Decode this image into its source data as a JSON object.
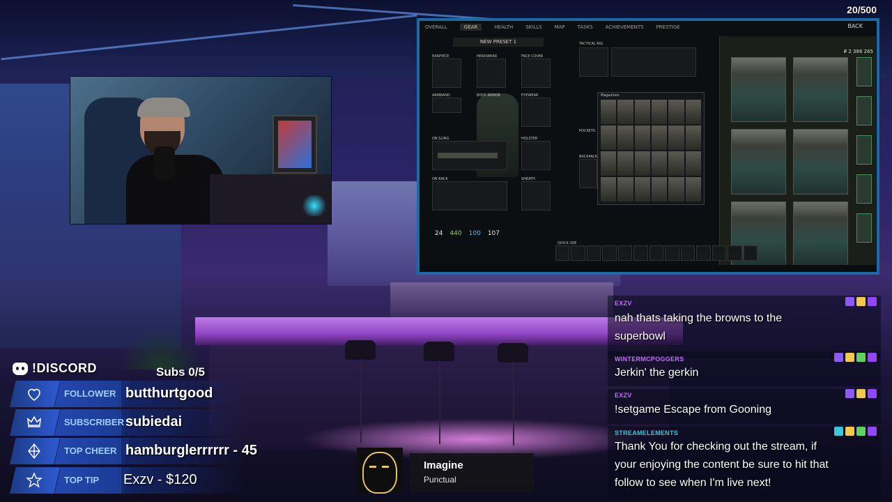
{
  "overlay": {
    "counter": "20/500",
    "discord_label": "!DISCORD",
    "subs": "Subs 0/5"
  },
  "stats": [
    {
      "label": "FOLLOWER",
      "value": "butthurtgood",
      "icon": "heart-icon"
    },
    {
      "label": "SUBSCRIBER",
      "value": "subiedai",
      "icon": "crown-icon"
    },
    {
      "label": "TOP CHEER",
      "value": "hamburglerrrrrr - 45",
      "icon": "diamond-icon"
    },
    {
      "label": "TOP TIP",
      "value": "Exzv - $120",
      "icon": "star-icon"
    }
  ],
  "music": {
    "title": "Imagine",
    "artist": "Punctual"
  },
  "game": {
    "menu": [
      "OVERALL",
      "GEAR",
      "HEALTH",
      "SKILLS",
      "MAP",
      "TASKS",
      "ACHIEVEMENTS",
      "PRESTIGE"
    ],
    "active_tab": "GEAR",
    "back_label": "BACK",
    "preset": "NEW PRESET 1",
    "slots": [
      "EARPIECE",
      "HEADWEAR",
      "FACE COVER",
      "ARMBAND",
      "BODY ARMOR",
      "EYEWEAR",
      "ON SLING",
      "HOLSTER",
      "ON BACK",
      "SHEATH",
      "TACTICAL RIG",
      "POCKETS",
      "BACKPACK"
    ],
    "magazines_title": "Magazines",
    "quick_use": "QUICK USE",
    "money": "₽ 2 386 265",
    "stats": {
      "level": "24",
      "health": "440",
      "hydration": "100",
      "energy": "107"
    }
  },
  "chat": [
    {
      "name": "EXZV",
      "name_color": "#c86bff",
      "text_lines": [
        "nah thats taking the browns to the",
        "superbowl"
      ],
      "badges": [
        "#8a5cf5",
        "#f2c94c",
        "#9146ff"
      ]
    },
    {
      "name": "WINTERMCPOGGERS",
      "name_color": "#c86bff",
      "text_lines": [
        "Jerkin' the gerkin"
      ],
      "badges": [
        "#8a5cf5",
        "#f2c94c",
        "#5fd35f",
        "#9146ff"
      ]
    },
    {
      "name": "EXZV",
      "name_color": "#c86bff",
      "text_lines": [
        "!setgame Escape from Gooning"
      ],
      "badges": [
        "#8a5cf5",
        "#f2c94c",
        "#9146ff"
      ]
    },
    {
      "name": "STREAMELEMENTS",
      "name_color": "#3cc7d8",
      "text_lines": [
        "Thank You for checking out the stream, if",
        "your enjoying the content be sure to hit that",
        "follow to see when I'm live next!"
      ],
      "badges": [
        "#3cc7d8",
        "#f2c94c",
        "#5fd35f",
        "#9146ff"
      ]
    }
  ]
}
